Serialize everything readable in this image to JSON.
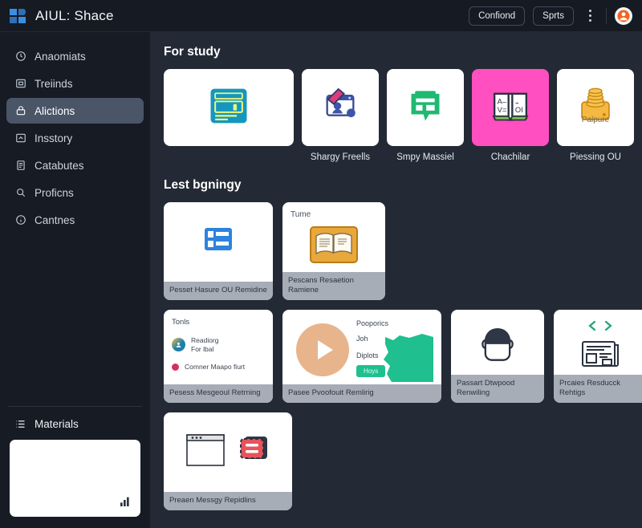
{
  "app": {
    "title": "AIUL: Shace",
    "logo_icon": "app-logo-icon"
  },
  "topbar": {
    "buttons": [
      {
        "label": "Confiond",
        "name": "confiond-button"
      },
      {
        "label": "Sprts",
        "name": "sprts-button"
      }
    ],
    "kebab_icon": "more-vertical-icon",
    "avatar_icon": "user-avatar-icon"
  },
  "sidebar": {
    "items": [
      {
        "label": "Anaomiats",
        "icon": "clock-icon",
        "active": false
      },
      {
        "label": "Treiinds",
        "icon": "image-icon",
        "active": false
      },
      {
        "label": "Alictions",
        "icon": "lock-icon",
        "active": true
      },
      {
        "label": "Insstory",
        "icon": "share-icon",
        "active": false
      },
      {
        "label": "Catabutes",
        "icon": "book-icon",
        "active": false
      },
      {
        "label": "Proficns",
        "icon": "search-icon",
        "active": false
      },
      {
        "label": "Cantnes",
        "icon": "info-icon",
        "active": false
      }
    ],
    "materials": {
      "label": "Materials",
      "icon": "list-icon",
      "badge_icon": "chart-bars-icon"
    }
  },
  "main": {
    "sections": [
      {
        "title": "For study",
        "name": "section-for-study",
        "tiles": [
          {
            "caption": "",
            "icon": "browser-window-icon",
            "bg": "#ffffff",
            "wide": true
          },
          {
            "caption": "Shargy Freells",
            "icon": "id-card-icon",
            "bg": "#ffffff",
            "wide": false
          },
          {
            "caption": "Smpy Massiel",
            "icon": "chat-document-icon",
            "bg": "#ffffff",
            "wide": false
          },
          {
            "caption": "Chachilar",
            "icon": "open-book-icon",
            "bg": "#ff4fc0",
            "wide": false
          },
          {
            "caption": "Piessing OU",
            "icon": "coins-icon",
            "bg": "#ffffff",
            "wide": false,
            "inner_label": "Palpure"
          }
        ]
      },
      {
        "title": "Lest bgningy",
        "name": "section-lest-bgningy",
        "cards_row_a": [
          {
            "caption": "Pesset Hasure OU\nRemidine",
            "icon": "layout-blocks-icon",
            "name": "card-pesset-hasure"
          },
          {
            "caption": "Pescans Resaetion\nRamiene",
            "icon": "open-book-frame-icon",
            "name": "card-pescans-resaetion",
            "inner_label": "Tume"
          }
        ],
        "cards_row_b": [
          {
            "caption": "Pesess Mesgeoul\nRetrning",
            "name": "card-pesess-mesgeoul",
            "kind": "tools",
            "tools_title": "Tonls",
            "tools": [
              {
                "text": "Readiorg\nFor lbal",
                "icon": "avatar-circle-icon"
              },
              {
                "text": "Comner Maapo fiurt",
                "icon": "red-dot-icon"
              }
            ]
          },
          {
            "caption": "Pasee Pvoofouit\nRemlirig",
            "name": "card-pasee-pvoofouit",
            "kind": "video",
            "play_icon": "play-icon",
            "lines": [
              "Pooporics",
              "Joh",
              "Diplots"
            ],
            "chip": "Hoys"
          },
          {
            "caption": "Passart Dtwpood\nRenwiling",
            "name": "card-passart-dtwpood",
            "kind": "head",
            "icon": "person-head-icon"
          },
          {
            "caption": "Prcaies Resducck\nRehtigs",
            "name": "card-prcaies-resducck",
            "kind": "code",
            "icon": "code-brackets-icon",
            "sub_icon": "newspaper-icon"
          }
        ],
        "cards_row_c": [
          {
            "caption": "Preaen Messgy\nRepidlins",
            "name": "card-preaen-messgy",
            "kind": "window",
            "icon": "window-icon",
            "sub_icon": "red-card-icon"
          }
        ]
      }
    ]
  },
  "colors": {
    "app_bg": "#151a23",
    "main_bg": "#242a35",
    "sidebar_bg": "#161b24",
    "active_nav": "#4a5568",
    "accent_pink": "#ff4fc0",
    "accent_green": "#1fbf8f",
    "caption_bar": "#a7adb7"
  }
}
